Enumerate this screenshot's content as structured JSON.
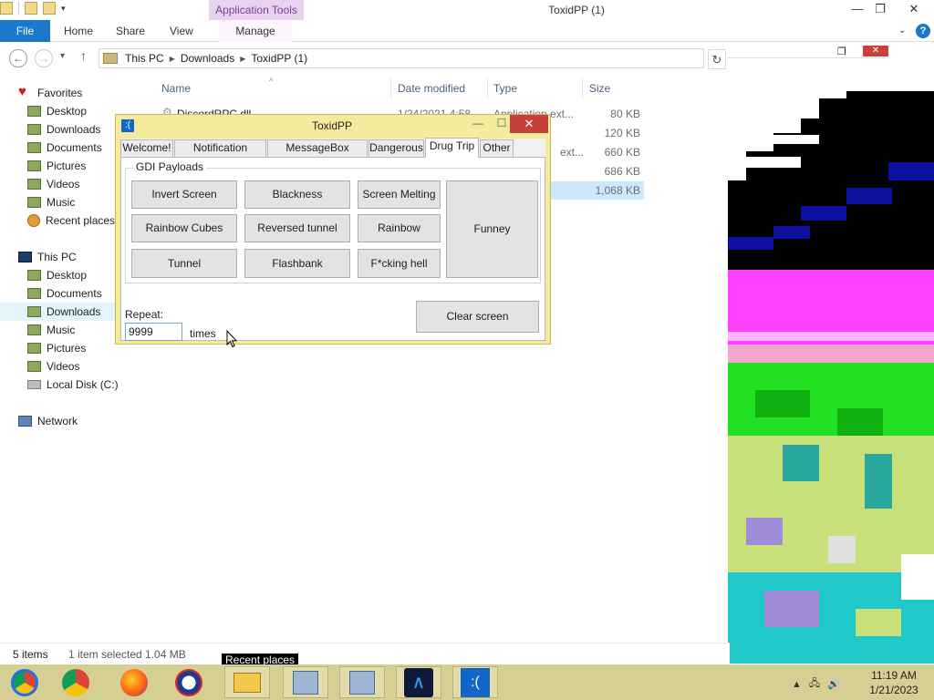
{
  "window": {
    "title": "ToxidPP (1)",
    "contextual_tab": "Application Tools"
  },
  "ribbon": {
    "file": "File",
    "tabs": [
      "Home",
      "Share",
      "View"
    ],
    "manage": "Manage"
  },
  "address": {
    "crumbs": [
      "This PC",
      "Downloads",
      "ToxidPP (1)"
    ]
  },
  "nav": {
    "favorites": "Favorites",
    "favorites_items": [
      "Desktop",
      "Downloads",
      "Documents",
      "Pictures",
      "Videos",
      "Music",
      "Recent places"
    ],
    "this_pc": "This PC",
    "pc_items": [
      "Desktop",
      "Documents",
      "Downloads",
      "Music",
      "Pictures",
      "Videos",
      "Local Disk (C:)"
    ],
    "network": "Network"
  },
  "filelist": {
    "columns": {
      "name": "Name",
      "date": "Date modified",
      "type": "Type",
      "size": "Size"
    },
    "rows": [
      {
        "name": "DiscordRPC.dll",
        "date": "1/24/2021 4:58",
        "type": "Application ext...",
        "size": "80 KB"
      },
      {
        "name": "",
        "date": "",
        "type": "",
        "size": "120 KB"
      },
      {
        "name": "",
        "date": "",
        "type": "ext...",
        "size": "660 KB"
      },
      {
        "name": "",
        "date": "",
        "type": "",
        "size": "686 KB"
      },
      {
        "name": "",
        "date": "",
        "type": "",
        "size": "1,068 KB"
      }
    ]
  },
  "status": {
    "items": "5 items",
    "selected": "1 item selected  1.04 MB",
    "tooltip": "Recent places"
  },
  "dialog": {
    "title": "ToxidPP",
    "icon": ":(",
    "min": "—",
    "max": "☐",
    "close": "✕",
    "tabs": [
      "Welcome!",
      "Notification Creator",
      "MessageBox Creator",
      "Dangerous",
      "Drug Trip",
      "Other"
    ],
    "active_tab": "Drug Trip",
    "group_label": "GDI Payloads",
    "buttons": {
      "invert": "Invert Screen",
      "blackness": "Blackness",
      "melting": "Screen Melting",
      "funney": "Funney",
      "rainbow_cubes": "Rainbow Cubes",
      "reversed_tunnel": "Reversed tunnel",
      "rainbow": "Rainbow",
      "tunnel": "Tunnel",
      "flashbank": "Flashbank",
      "fcking_hell": "F*cking hell",
      "clear": "Clear screen"
    },
    "repeat_label": "Repeat:",
    "repeat_value": "9999",
    "times_label": "times"
  },
  "taskbar": {
    "apps": [
      "chrome-icon",
      "firefox-icon",
      "opera-icon",
      "explorer-icon",
      "network-icon",
      "network-icon",
      "blue-logo-icon",
      "bsod-icon"
    ],
    "bsod_glyph": ":(",
    "time": "11:19 AM",
    "date": "1/21/2023"
  },
  "colors": {
    "dialog_frame": "#f4ec9c",
    "taskbar": "#d6cf93",
    "accent": "#1979ca",
    "close": "#c7403a"
  }
}
